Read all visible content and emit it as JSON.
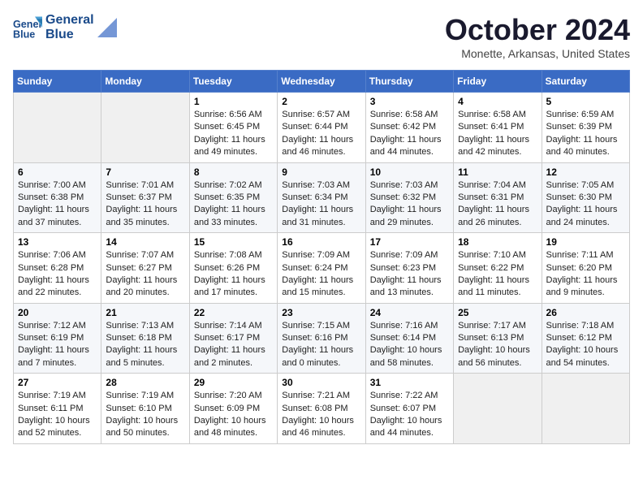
{
  "header": {
    "logo_line1": "General",
    "logo_line2": "Blue",
    "month_title": "October 2024",
    "subtitle": "Monette, Arkansas, United States"
  },
  "days_of_week": [
    "Sunday",
    "Monday",
    "Tuesday",
    "Wednesday",
    "Thursday",
    "Friday",
    "Saturday"
  ],
  "weeks": [
    [
      {
        "day": "",
        "sunrise": "",
        "sunset": "",
        "daylight": ""
      },
      {
        "day": "",
        "sunrise": "",
        "sunset": "",
        "daylight": ""
      },
      {
        "day": "1",
        "sunrise": "Sunrise: 6:56 AM",
        "sunset": "Sunset: 6:45 PM",
        "daylight": "Daylight: 11 hours and 49 minutes."
      },
      {
        "day": "2",
        "sunrise": "Sunrise: 6:57 AM",
        "sunset": "Sunset: 6:44 PM",
        "daylight": "Daylight: 11 hours and 46 minutes."
      },
      {
        "day": "3",
        "sunrise": "Sunrise: 6:58 AM",
        "sunset": "Sunset: 6:42 PM",
        "daylight": "Daylight: 11 hours and 44 minutes."
      },
      {
        "day": "4",
        "sunrise": "Sunrise: 6:58 AM",
        "sunset": "Sunset: 6:41 PM",
        "daylight": "Daylight: 11 hours and 42 minutes."
      },
      {
        "day": "5",
        "sunrise": "Sunrise: 6:59 AM",
        "sunset": "Sunset: 6:39 PM",
        "daylight": "Daylight: 11 hours and 40 minutes."
      }
    ],
    [
      {
        "day": "6",
        "sunrise": "Sunrise: 7:00 AM",
        "sunset": "Sunset: 6:38 PM",
        "daylight": "Daylight: 11 hours and 37 minutes."
      },
      {
        "day": "7",
        "sunrise": "Sunrise: 7:01 AM",
        "sunset": "Sunset: 6:37 PM",
        "daylight": "Daylight: 11 hours and 35 minutes."
      },
      {
        "day": "8",
        "sunrise": "Sunrise: 7:02 AM",
        "sunset": "Sunset: 6:35 PM",
        "daylight": "Daylight: 11 hours and 33 minutes."
      },
      {
        "day": "9",
        "sunrise": "Sunrise: 7:03 AM",
        "sunset": "Sunset: 6:34 PM",
        "daylight": "Daylight: 11 hours and 31 minutes."
      },
      {
        "day": "10",
        "sunrise": "Sunrise: 7:03 AM",
        "sunset": "Sunset: 6:32 PM",
        "daylight": "Daylight: 11 hours and 29 minutes."
      },
      {
        "day": "11",
        "sunrise": "Sunrise: 7:04 AM",
        "sunset": "Sunset: 6:31 PM",
        "daylight": "Daylight: 11 hours and 26 minutes."
      },
      {
        "day": "12",
        "sunrise": "Sunrise: 7:05 AM",
        "sunset": "Sunset: 6:30 PM",
        "daylight": "Daylight: 11 hours and 24 minutes."
      }
    ],
    [
      {
        "day": "13",
        "sunrise": "Sunrise: 7:06 AM",
        "sunset": "Sunset: 6:28 PM",
        "daylight": "Daylight: 11 hours and 22 minutes."
      },
      {
        "day": "14",
        "sunrise": "Sunrise: 7:07 AM",
        "sunset": "Sunset: 6:27 PM",
        "daylight": "Daylight: 11 hours and 20 minutes."
      },
      {
        "day": "15",
        "sunrise": "Sunrise: 7:08 AM",
        "sunset": "Sunset: 6:26 PM",
        "daylight": "Daylight: 11 hours and 17 minutes."
      },
      {
        "day": "16",
        "sunrise": "Sunrise: 7:09 AM",
        "sunset": "Sunset: 6:24 PM",
        "daylight": "Daylight: 11 hours and 15 minutes."
      },
      {
        "day": "17",
        "sunrise": "Sunrise: 7:09 AM",
        "sunset": "Sunset: 6:23 PM",
        "daylight": "Daylight: 11 hours and 13 minutes."
      },
      {
        "day": "18",
        "sunrise": "Sunrise: 7:10 AM",
        "sunset": "Sunset: 6:22 PM",
        "daylight": "Daylight: 11 hours and 11 minutes."
      },
      {
        "day": "19",
        "sunrise": "Sunrise: 7:11 AM",
        "sunset": "Sunset: 6:20 PM",
        "daylight": "Daylight: 11 hours and 9 minutes."
      }
    ],
    [
      {
        "day": "20",
        "sunrise": "Sunrise: 7:12 AM",
        "sunset": "Sunset: 6:19 PM",
        "daylight": "Daylight: 11 hours and 7 minutes."
      },
      {
        "day": "21",
        "sunrise": "Sunrise: 7:13 AM",
        "sunset": "Sunset: 6:18 PM",
        "daylight": "Daylight: 11 hours and 5 minutes."
      },
      {
        "day": "22",
        "sunrise": "Sunrise: 7:14 AM",
        "sunset": "Sunset: 6:17 PM",
        "daylight": "Daylight: 11 hours and 2 minutes."
      },
      {
        "day": "23",
        "sunrise": "Sunrise: 7:15 AM",
        "sunset": "Sunset: 6:16 PM",
        "daylight": "Daylight: 11 hours and 0 minutes."
      },
      {
        "day": "24",
        "sunrise": "Sunrise: 7:16 AM",
        "sunset": "Sunset: 6:14 PM",
        "daylight": "Daylight: 10 hours and 58 minutes."
      },
      {
        "day": "25",
        "sunrise": "Sunrise: 7:17 AM",
        "sunset": "Sunset: 6:13 PM",
        "daylight": "Daylight: 10 hours and 56 minutes."
      },
      {
        "day": "26",
        "sunrise": "Sunrise: 7:18 AM",
        "sunset": "Sunset: 6:12 PM",
        "daylight": "Daylight: 10 hours and 54 minutes."
      }
    ],
    [
      {
        "day": "27",
        "sunrise": "Sunrise: 7:19 AM",
        "sunset": "Sunset: 6:11 PM",
        "daylight": "Daylight: 10 hours and 52 minutes."
      },
      {
        "day": "28",
        "sunrise": "Sunrise: 7:19 AM",
        "sunset": "Sunset: 6:10 PM",
        "daylight": "Daylight: 10 hours and 50 minutes."
      },
      {
        "day": "29",
        "sunrise": "Sunrise: 7:20 AM",
        "sunset": "Sunset: 6:09 PM",
        "daylight": "Daylight: 10 hours and 48 minutes."
      },
      {
        "day": "30",
        "sunrise": "Sunrise: 7:21 AM",
        "sunset": "Sunset: 6:08 PM",
        "daylight": "Daylight: 10 hours and 46 minutes."
      },
      {
        "day": "31",
        "sunrise": "Sunrise: 7:22 AM",
        "sunset": "Sunset: 6:07 PM",
        "daylight": "Daylight: 10 hours and 44 minutes."
      },
      {
        "day": "",
        "sunrise": "",
        "sunset": "",
        "daylight": ""
      },
      {
        "day": "",
        "sunrise": "",
        "sunset": "",
        "daylight": ""
      }
    ]
  ]
}
